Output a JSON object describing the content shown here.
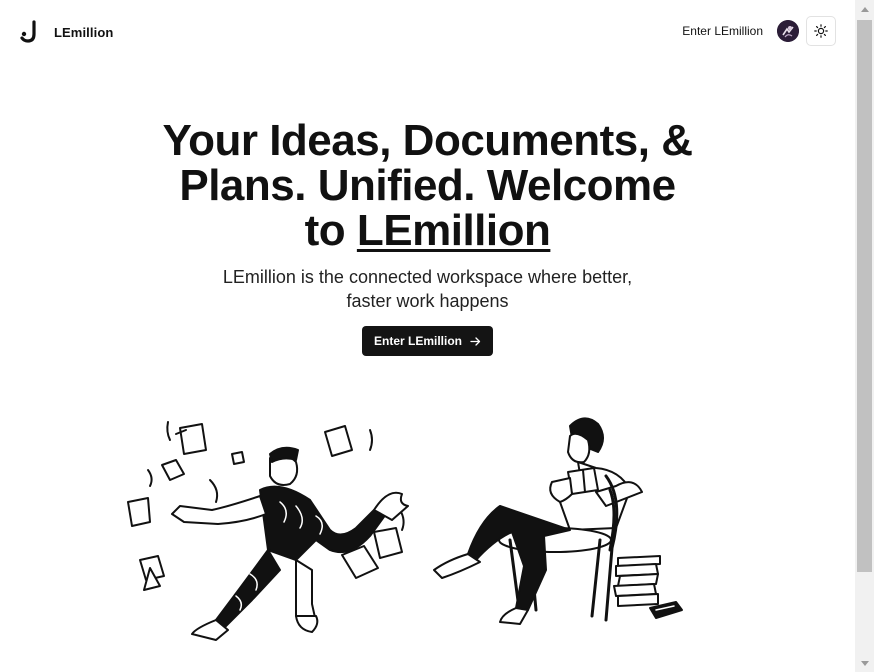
{
  "nav": {
    "brand_name": "LEmillion",
    "enter_link": "Enter LEmillion",
    "logo_icon": "j-logo-icon",
    "avatar_icon": "user-avatar",
    "theme_icon": "sun-icon"
  },
  "hero": {
    "title_line1": "Your Ideas, Documents, &",
    "title_line2": "Plans. Unified. Welcome",
    "title_to": "to ",
    "title_brand": "LEmillion",
    "subtitle": "LEmillion is the connected workspace where better, faster work happens",
    "cta_label": "Enter LEmillion",
    "cta_icon": "arrow-right-icon"
  },
  "colors": {
    "text": "#111111",
    "cta_bg": "#141414",
    "cta_text": "#ffffff",
    "scrollbar_track": "#f1f1f1",
    "scrollbar_thumb": "#c1c1c1"
  },
  "illustrations": {
    "left": "person-juggling-papers",
    "right": "person-reading-on-chair"
  }
}
